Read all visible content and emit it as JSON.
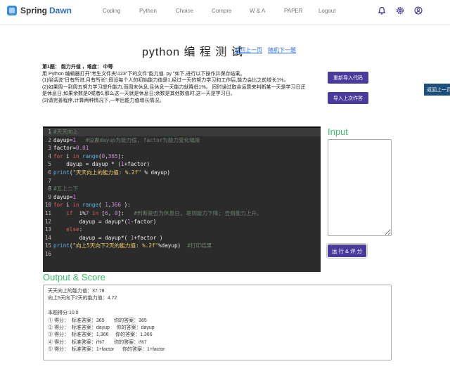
{
  "nav": {
    "brand_a": "Spring",
    "brand_b": "Dawn",
    "links": [
      "Coding",
      "Python",
      "Choice",
      "Compre",
      "W & A",
      "PAPER",
      "Logout"
    ]
  },
  "header": {
    "title": "python 编 程 测 试",
    "prev_link": "返回上一页",
    "random_link": "随机下一题"
  },
  "task": {
    "heading": "第1题：  能力升值 ，难度：  中等",
    "lines": [
      "用 Python 编辑器打开\"考生文件夹\\123\"下的文件\"能力值. py \"如下,进行以下操作并保存结果。",
      "(1)俗话说\"日有所进,月有所长\",假设每个人的初始能力值是1,经过一天的努力学习和工作后,能力会比之前增长1%。",
      "(2)如果周一到周五努力学习提升能力,而周末休息,且休息一天能力就降低1%。 同时通过取余运算来判断某一天是学习日还",
      "是休息日,如果余数是0或者6,那么这一天就是休息日;余数是其他数值时,这一天是学习日。",
      "(3)请完善程序,计算两种情况下,一年后能力值增长情况。"
    ]
  },
  "buttons": {
    "reimport": "重新导入代码",
    "import_last": "导入上次作答",
    "side_back": "返回上一页",
    "run": "运 行 & 评 分"
  },
  "code": {
    "lines": [
      [
        {
          "c": "cm",
          "t": "#天天向上"
        }
      ],
      [
        {
          "c": "tx",
          "t": "dayup"
        },
        {
          "c": "op",
          "t": "="
        },
        {
          "c": "num",
          "t": "1"
        },
        {
          "c": "tx",
          "t": "   "
        },
        {
          "c": "cm",
          "t": "#设置dayup为能力值, factor为能力变化幅度"
        }
      ],
      [
        {
          "c": "tx",
          "t": "factor"
        },
        {
          "c": "op",
          "t": "="
        },
        {
          "c": "num",
          "t": "0.01"
        }
      ],
      [
        {
          "c": "kw",
          "t": "for"
        },
        {
          "c": "tx",
          "t": " i "
        },
        {
          "c": "kw",
          "t": "in"
        },
        {
          "c": "tx",
          "t": " "
        },
        {
          "c": "fn",
          "t": "range"
        },
        {
          "c": "tx",
          "t": "("
        },
        {
          "c": "num",
          "t": "0"
        },
        {
          "c": "tx",
          "t": ","
        },
        {
          "c": "num",
          "t": "365"
        },
        {
          "c": "tx",
          "t": "):"
        }
      ],
      [
        {
          "c": "tx",
          "t": "    dayup = dayup * ("
        },
        {
          "c": "num",
          "t": "1"
        },
        {
          "c": "tx",
          "t": "+factor)"
        }
      ],
      [
        {
          "c": "fn",
          "t": "print"
        },
        {
          "c": "tx",
          "t": "("
        },
        {
          "c": "str",
          "t": "\"天天向上的能力值: %.2f\""
        },
        {
          "c": "tx",
          "t": " % dayup)"
        }
      ],
      [],
      [
        {
          "c": "cm",
          "t": "#五上二下"
        }
      ],
      [
        {
          "c": "tx",
          "t": "dayup"
        },
        {
          "c": "op",
          "t": "="
        },
        {
          "c": "num",
          "t": "1"
        }
      ],
      [
        {
          "c": "kw",
          "t": "for"
        },
        {
          "c": "tx",
          "t": " i "
        },
        {
          "c": "kw",
          "t": "in"
        },
        {
          "c": "tx",
          "t": " "
        },
        {
          "c": "fn",
          "t": "range"
        },
        {
          "c": "tx",
          "t": "( "
        },
        {
          "c": "num",
          "t": "1"
        },
        {
          "c": "tx",
          "t": ","
        },
        {
          "c": "num",
          "t": "366"
        },
        {
          "c": "tx",
          "t": " ):"
        }
      ],
      [
        {
          "c": "tx",
          "t": "    "
        },
        {
          "c": "kw",
          "t": "if"
        },
        {
          "c": "tx",
          "t": "  i%"
        },
        {
          "c": "num",
          "t": "7"
        },
        {
          "c": "tx",
          "t": " "
        },
        {
          "c": "kw",
          "t": "in"
        },
        {
          "c": "tx",
          "t": " ["
        },
        {
          "c": "num",
          "t": "6"
        },
        {
          "c": "tx",
          "t": ", "
        },
        {
          "c": "num",
          "t": "0"
        },
        {
          "c": "tx",
          "t": "]:   "
        },
        {
          "c": "cm",
          "t": "#判断是否为休息日, 是则能力下降; 否则能力上升。"
        }
      ],
      [
        {
          "c": "tx",
          "t": "        dayup = dayup*("
        },
        {
          "c": "num",
          "t": "1"
        },
        {
          "c": "tx",
          "t": "-factor)"
        }
      ],
      [
        {
          "c": "tx",
          "t": "    "
        },
        {
          "c": "kw",
          "t": "else"
        },
        {
          "c": "tx",
          "t": ":"
        }
      ],
      [
        {
          "c": "tx",
          "t": "        dayup = dayup*( "
        },
        {
          "c": "num",
          "t": "1"
        },
        {
          "c": "tx",
          "t": "+factor )"
        }
      ],
      [
        {
          "c": "fn",
          "t": "print"
        },
        {
          "c": "tx",
          "t": "("
        },
        {
          "c": "str",
          "t": "\"向上5天向下2天的能力值: %.2f\""
        },
        {
          "c": "tx",
          "t": "%dayup)  "
        },
        {
          "c": "cm",
          "t": "#打印结果"
        }
      ],
      []
    ]
  },
  "input": {
    "label": "Input",
    "value": ""
  },
  "output": {
    "label": "Output & Score",
    "lines": [
      "天天向上的能力值：37.78",
      "向上5天向下2天的能力值：4.72",
      "",
      "本题得分:10.0",
      "① 得分：  标准答案：365       你的答案：365",
      "② 得分：  标准答案：dayup     你的答案：dayup",
      "③ 得分：  标准答案：1,366     你的答案：1,366",
      "④ 得分：  标准答案：i%7       你的答案：i%7",
      "⑤ 得分：  标准答案：1+factor      你的答案：1+factor"
    ]
  },
  "icons": [
    "bell-icon",
    "gear-icon",
    "user-icon"
  ],
  "colors": {
    "accent": "#4b3a9c",
    "green": "#3fb96b",
    "editor_bg": "#2b2b2b",
    "link": "#2a6bd6"
  }
}
